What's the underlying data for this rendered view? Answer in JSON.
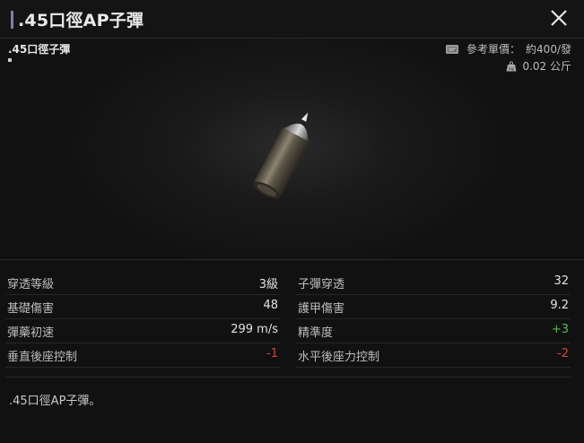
{
  "header": {
    "title": ".45口徑AP子彈"
  },
  "item": {
    "name": ".45口徑子彈",
    "price_label": "參考單價：",
    "price_value": "約400/發",
    "weight_value": "0.02 公斤"
  },
  "icons": {
    "close": "close-icon",
    "price": "price-tag-icon",
    "weight": "weight-icon",
    "item_image": "bullet-image"
  },
  "stats": {
    "left": [
      {
        "label": "穿透等級",
        "value": "3級",
        "tone": "normal"
      },
      {
        "label": "基礎傷害",
        "value": "48",
        "tone": "normal"
      },
      {
        "label": "彈藥初速",
        "value": "299 m/s",
        "tone": "normal"
      },
      {
        "label": "垂直後座控制",
        "value": "-1",
        "tone": "neg"
      }
    ],
    "right": [
      {
        "label": "子彈穿透",
        "value": "32",
        "tone": "normal"
      },
      {
        "label": "護甲傷害",
        "value": "9.2",
        "tone": "normal"
      },
      {
        "label": "精準度",
        "value": "+3",
        "tone": "pos"
      },
      {
        "label": "水平後座力控制",
        "value": "-2",
        "tone": "neg"
      }
    ]
  },
  "description": ".45口徑AP子彈。",
  "colors": {
    "positive": "#62b45a",
    "negative": "#d34a3a",
    "accent": "#8a7aa8"
  }
}
